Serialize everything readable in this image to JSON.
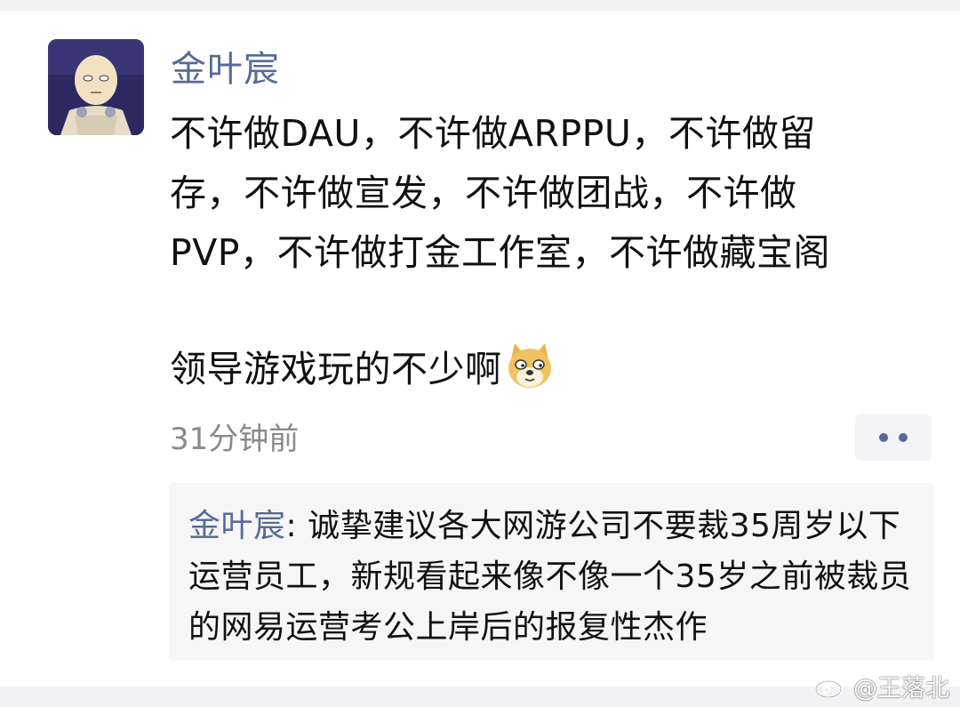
{
  "post": {
    "username": "金叶宸",
    "text": "不许做DAU，不许做ARPPU，不许做留\n存，不许做宣发，不许做团战，不许做\nPVP，不许做打金工作室，不许做藏宝阁",
    "line2": "领导游戏玩的不少啊",
    "emoji_icon": "doge-emoji",
    "timestamp": "31分钟前",
    "more_icon": "more-dots-icon"
  },
  "comment": {
    "author": "金叶宸",
    "separator": ": ",
    "text": "诚挚建议各大网游公司不要裁35周岁以下运营员工，新规看起来像不像一个35岁之前被裁员的网易运营考公上岸后的报复性杰作"
  },
  "watermark": {
    "icon": "weibo-logo-icon",
    "text": "@王落北"
  },
  "colors": {
    "name_link": "#576b95",
    "text": "#111111",
    "timestamp": "#8a8a8a",
    "comment_bg": "#f6f6f7"
  }
}
